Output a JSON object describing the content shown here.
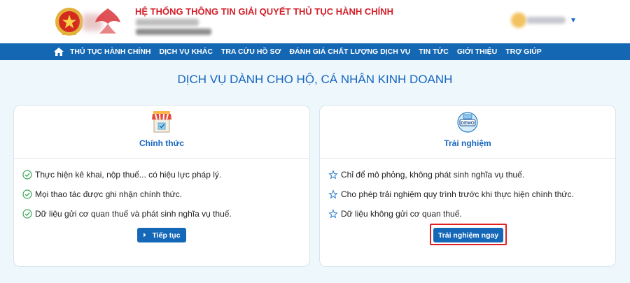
{
  "header": {
    "system_title": "HỆ THỐNG THÔNG TIN GIẢI QUYẾT THỦ TỤC HÀNH CHÍNH"
  },
  "nav": {
    "items": [
      {
        "label": "THỦ TỤC HÀNH CHÍNH"
      },
      {
        "label": "DỊCH VỤ KHÁC"
      },
      {
        "label": "TRA CỨU HỒ SƠ"
      },
      {
        "label": "ĐÁNH GIÁ CHẤT LƯỢNG DỊCH VỤ"
      },
      {
        "label": "TIN TỨC"
      },
      {
        "label": "GIỚI THIỆU"
      },
      {
        "label": "TRỢ GIÚP"
      }
    ]
  },
  "page": {
    "title": "DỊCH VỤ DÀNH CHO HỘ, CÁ NHÂN KINH DOANH"
  },
  "official_card": {
    "heading": "Chính thức",
    "icon": "store-icon",
    "features": [
      {
        "text": "Thực hiện kê khai, nộp thuế... có hiệu lực pháp lý."
      },
      {
        "text": "Mọi thao tác được ghi nhận chính thức."
      },
      {
        "text": "Dữ liệu gửi cơ quan thuế và phát sinh nghĩa vụ thuế."
      }
    ],
    "button_label": "Tiếp tục"
  },
  "demo_card": {
    "heading": "Trải nghiệm",
    "icon": "demo-icon",
    "features": [
      {
        "text": "Chỉ để mô phỏng, không phát sinh nghĩa vụ thuế."
      },
      {
        "text": "Cho phép trải nghiệm quy trình trước khi thực hiện chính thức."
      },
      {
        "text": "Dữ liệu không gửi cơ quan thuế."
      }
    ],
    "button_label": "Trải nghiệm ngay"
  },
  "colors": {
    "primary": "#1567b8",
    "title_red": "#d4202a",
    "highlight": "#e02020",
    "check_green": "#3aa657"
  }
}
